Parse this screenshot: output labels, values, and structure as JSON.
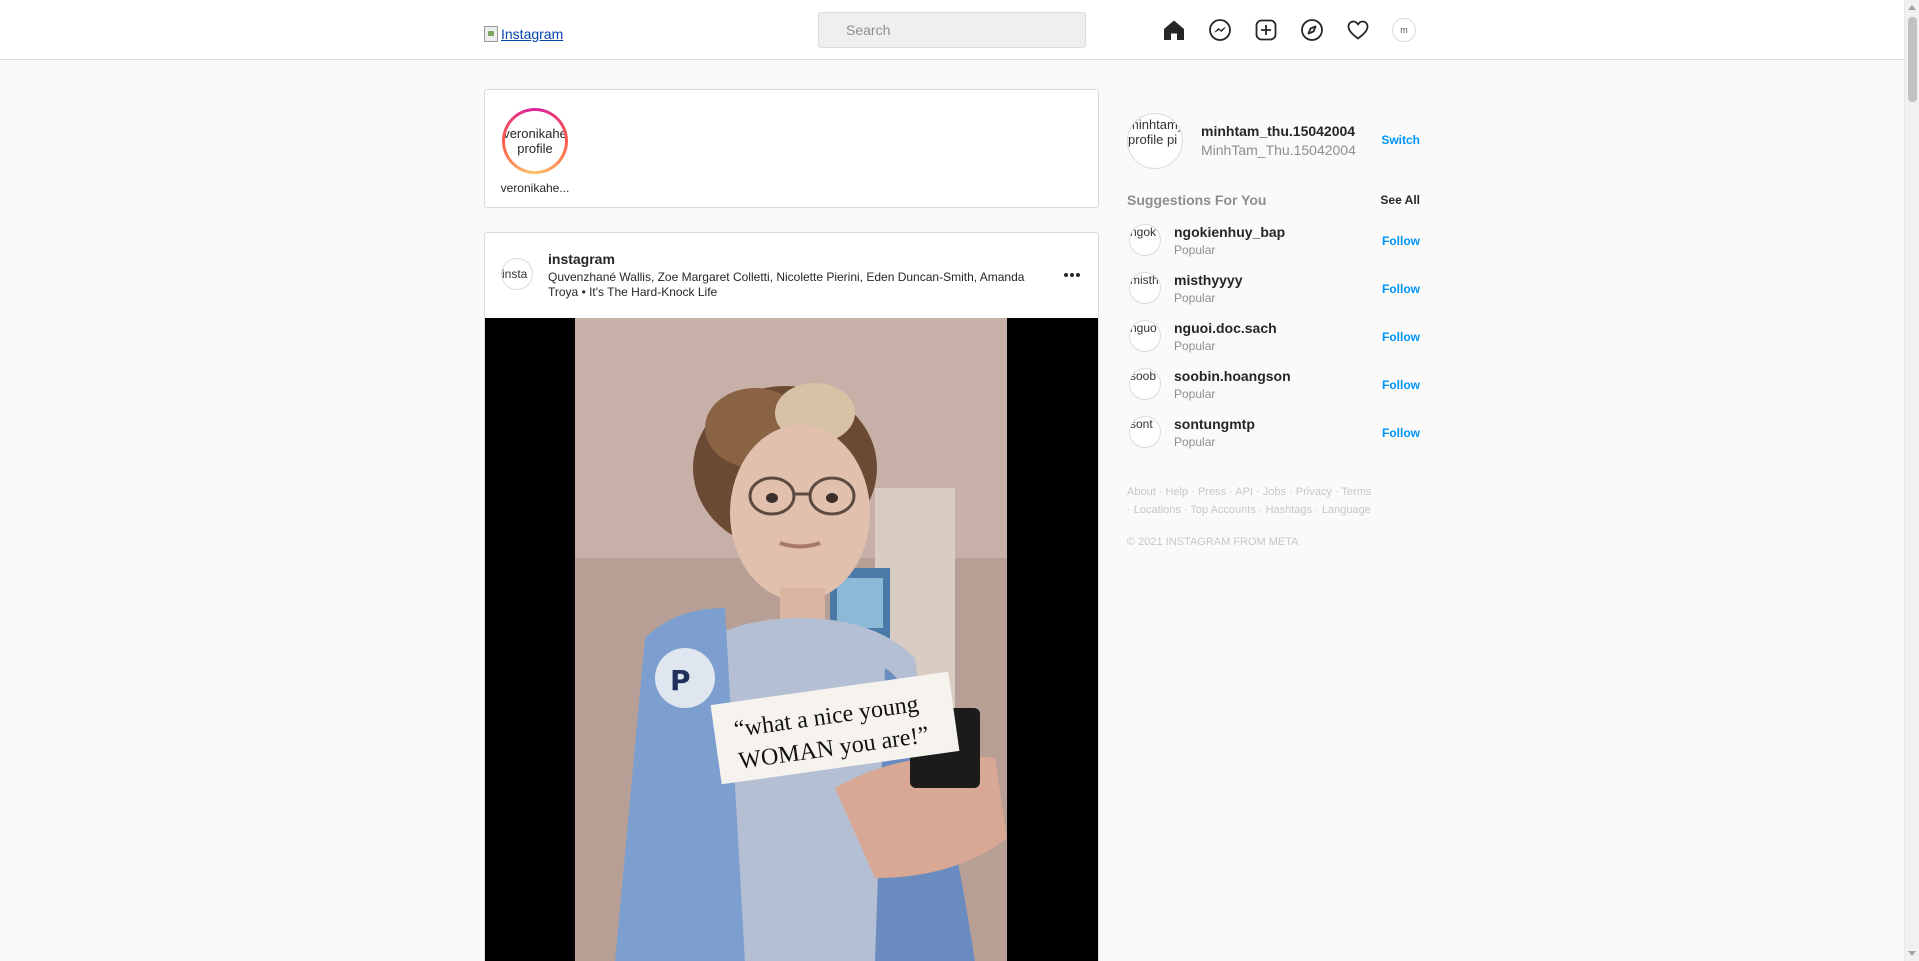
{
  "nav": {
    "logo_alt": "Instagram",
    "search_placeholder": "Search",
    "avatar_alt": "m"
  },
  "stories": [
    {
      "avatar_alt": "veronikahe profile",
      "username": "veronikahe..."
    }
  ],
  "post": {
    "username": "instagram",
    "avatar_alt": "insta",
    "caption": "Quvenzhané Wallis, Zoe Margaret Colletti, Nicolette Pierini, Eden Duncan-Smith, Amanda Troya • It's The Hard-Knock Life",
    "overlay_text_line1": "“what a nice young",
    "overlay_text_line2": "WOMAN you are!”"
  },
  "sidebar": {
    "me": {
      "username": "minhtam_thu.15042004",
      "full_name": "MinhTam_Thu.15042004",
      "avatar_alt": "minhtam_ profile pi",
      "switch_label": "Switch"
    },
    "suggestions_title": "Suggestions For You",
    "see_all_label": "See All",
    "suggestions": [
      {
        "username": "ngokienhuy_bap",
        "subtitle": "Popular",
        "follow_label": "Follow",
        "avatar_alt": "ngok"
      },
      {
        "username": "misthyyyy",
        "subtitle": "Popular",
        "follow_label": "Follow",
        "avatar_alt": "misth"
      },
      {
        "username": "nguoi.doc.sach",
        "subtitle": "Popular",
        "follow_label": "Follow",
        "avatar_alt": "nguo"
      },
      {
        "username": "soobin.hoangson",
        "subtitle": "Popular",
        "follow_label": "Follow",
        "avatar_alt": "soob"
      },
      {
        "username": "sontungmtp",
        "subtitle": "Popular",
        "follow_label": "Follow",
        "avatar_alt": "sont"
      }
    ],
    "footer_links": [
      "About",
      "Help",
      "Press",
      "API",
      "Jobs",
      "Privacy",
      "Terms",
      "Locations",
      "Top Accounts",
      "Hashtags",
      "Language"
    ],
    "copyright": "© 2021 INSTAGRAM FROM META"
  },
  "colors": {
    "accent": "#0095f6",
    "border": "#dbdbdb",
    "background": "#fafafa",
    "muted": "#8e8e8e"
  }
}
